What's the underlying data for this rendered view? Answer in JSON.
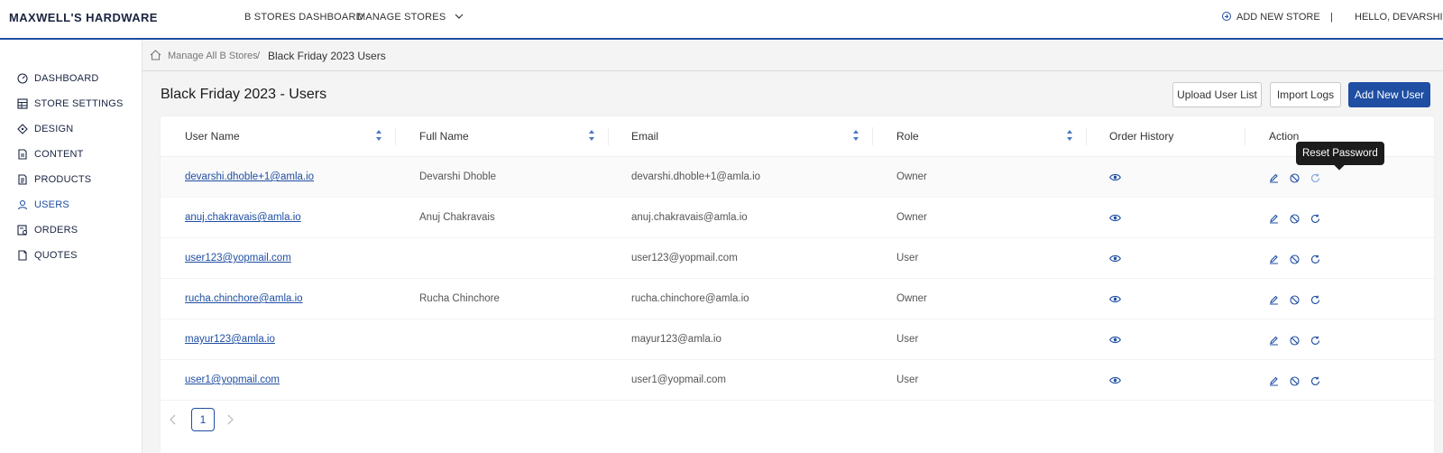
{
  "brand": "MAXWELL'S HARDWARE",
  "topnav": {
    "dashboard": "B STORES DASHBOARD",
    "manage_stores": "MANAGE STORES",
    "add_new_store": "ADD NEW STORE",
    "separator": "|",
    "greeting": "HELLO, DEVARSHI"
  },
  "sidebar": {
    "items": [
      {
        "label": "DASHBOARD",
        "icon": "gauge-icon"
      },
      {
        "label": "STORE SETTINGS",
        "icon": "store-settings-icon"
      },
      {
        "label": "DESIGN",
        "icon": "design-icon"
      },
      {
        "label": "CONTENT",
        "icon": "content-icon"
      },
      {
        "label": "PRODUCTS",
        "icon": "products-icon"
      },
      {
        "label": "USERS",
        "icon": "user-icon",
        "active": true
      },
      {
        "label": "ORDERS",
        "icon": "orders-icon"
      },
      {
        "label": "QUOTES",
        "icon": "quotes-icon"
      }
    ]
  },
  "breadcrumb": {
    "parent": "Manage All B Stores",
    "separator": "/",
    "current": "Black Friday 2023 Users"
  },
  "page": {
    "title": "Black Friday 2023 - Users",
    "upload_label": "Upload User List",
    "import_label": "Import Logs",
    "add_user_label": "Add New User"
  },
  "table": {
    "headers": {
      "username": "User Name",
      "fullname": "Full Name",
      "email": "Email",
      "role": "Role",
      "order_history": "Order History",
      "action": "Action"
    },
    "rows": [
      {
        "username": "devarshi.dhoble+1@amla.io",
        "fullname": "Devarshi Dhoble",
        "email": "devarshi.dhoble+1@amla.io",
        "role": "Owner"
      },
      {
        "username": "anuj.chakravais@amla.io",
        "fullname": "Anuj Chakravais",
        "email": "anuj.chakravais@amla.io",
        "role": "Owner"
      },
      {
        "username": "user123@yopmail.com",
        "fullname": "",
        "email": "user123@yopmail.com",
        "role": "User"
      },
      {
        "username": "rucha.chinchore@amla.io",
        "fullname": "Rucha Chinchore",
        "email": "rucha.chinchore@amla.io",
        "role": "Owner"
      },
      {
        "username": "mayur123@amla.io",
        "fullname": "",
        "email": "mayur123@amla.io",
        "role": "User"
      },
      {
        "username": "user1@yopmail.com",
        "fullname": "",
        "email": "user1@yopmail.com",
        "role": "User"
      }
    ]
  },
  "tooltip": "Reset Password",
  "pagination": {
    "current": "1"
  },
  "colors": {
    "accent": "#1f4ea3",
    "brand_text": "#1a2440",
    "background": "#f4f4f4"
  }
}
